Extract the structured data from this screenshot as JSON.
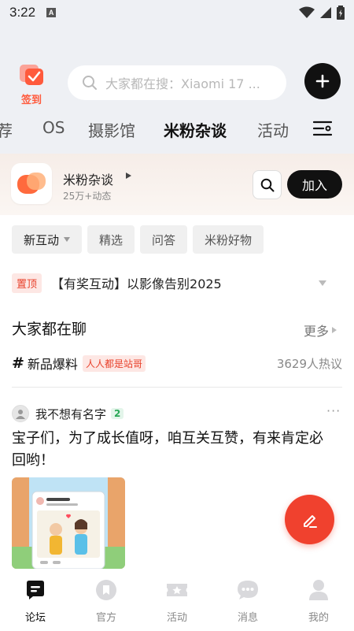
{
  "status_bar": {
    "time": "3:22",
    "notification_letter": "A"
  },
  "header": {
    "checkin_label": "签到",
    "search_placeholder": "大家都在搜：Xiaomi 17 ...",
    "tabs": [
      {
        "label": "荐",
        "active": false
      },
      {
        "label": "OS",
        "active": false
      },
      {
        "label": "摄影馆",
        "active": false
      },
      {
        "label": "米粉杂谈",
        "active": true
      },
      {
        "label": "活动",
        "active": false
      }
    ]
  },
  "forum": {
    "name": "米粉杂谈",
    "meta": "25万+动态",
    "join_label": "加入"
  },
  "filters": [
    {
      "label": "新互动",
      "active": true
    },
    {
      "label": "精选",
      "active": false
    },
    {
      "label": "问答",
      "active": false
    },
    {
      "label": "米粉好物",
      "active": false
    }
  ],
  "pinned": {
    "badge": "置顶",
    "title": "【有奖互动】以影像告别2025"
  },
  "trending": {
    "title": "大家都在聊",
    "more_label": "更多",
    "topic": {
      "hash": "#",
      "title": "新品爆料",
      "tag": "人人都是站哥",
      "count": "3629人热议"
    }
  },
  "post": {
    "author": "我不想有名字",
    "level": "2",
    "more": "···",
    "text": "宝子们，为了成长值呀，咱互关互赞，有来肯定必回哟！"
  },
  "bottom_nav": [
    {
      "label": "论坛",
      "active": true
    },
    {
      "label": "官方",
      "active": false
    },
    {
      "label": "活动",
      "active": false
    },
    {
      "label": "消息",
      "active": false
    },
    {
      "label": "我的",
      "active": false
    }
  ],
  "colors": {
    "accent": "#f0412e",
    "header_bg": "#eef0f4",
    "primary_dark": "#111111"
  }
}
